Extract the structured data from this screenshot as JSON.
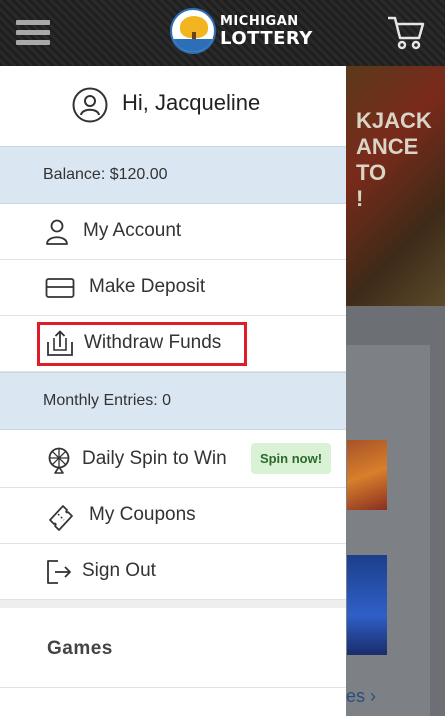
{
  "header": {
    "logo_line1": "MICHIGAN",
    "logo_line2": "LOTTERY"
  },
  "background": {
    "promo_text": "KJACK\nANCE\nTO\n!",
    "link_text": "es"
  },
  "drawer": {
    "greeting": "Hi, Jacqueline",
    "balance": "Balance: $120.00",
    "account_items": [
      {
        "label": "My Account",
        "icon": "user-icon"
      },
      {
        "label": "Make Deposit",
        "icon": "credit-card-icon"
      },
      {
        "label": "Withdraw Funds",
        "icon": "upload-tray-icon",
        "highlighted": true
      }
    ],
    "monthly_entries": "Monthly Entries: 0",
    "entry_items": [
      {
        "label": "Daily Spin to Win",
        "icon": "wheel-icon",
        "badge": "Spin now!"
      },
      {
        "label": "My Coupons",
        "icon": "ticket-icon"
      },
      {
        "label": "Sign Out",
        "icon": "sign-out-icon"
      }
    ],
    "section_games": "Games"
  },
  "colors": {
    "highlight_border": "#e01b2a",
    "band_bg": "#dbe6f3",
    "badge_bg": "#d9f2d5"
  }
}
